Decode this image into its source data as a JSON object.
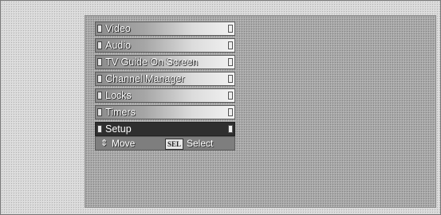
{
  "menu": {
    "items": [
      {
        "label": "Video",
        "selected": false
      },
      {
        "label": "Audio",
        "selected": false
      },
      {
        "label": "TV Guide On Screen",
        "selected": false
      },
      {
        "label": "Channel Manager",
        "selected": false
      },
      {
        "label": "Locks",
        "selected": false
      },
      {
        "label": "Timers",
        "selected": false
      },
      {
        "label": "Setup",
        "selected": true
      }
    ]
  },
  "help": {
    "move_icon": "up-down-arrow-icon",
    "move_label": "Move",
    "select_key": "SEL",
    "select_label": "Select"
  },
  "colors": {
    "selected_item_bg": "#2f2f2f",
    "panel_bg": "#a9a9a9"
  }
}
